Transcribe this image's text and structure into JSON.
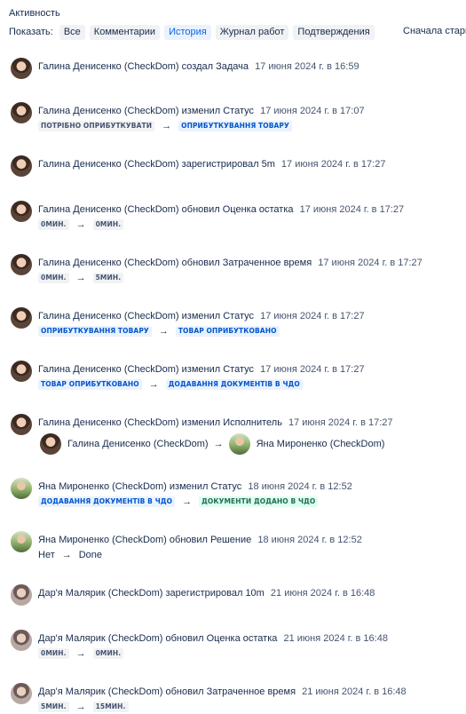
{
  "header": {
    "title": "Активность"
  },
  "filters": {
    "label": "Показать:",
    "buttons": [
      "Все",
      "Комментарии",
      "История",
      "Журнал работ",
      "Подтверждения"
    ],
    "active": "История",
    "sort_label": "Сначала старые"
  },
  "entries": [
    {
      "user": "Галина Денисенко (CheckDom)",
      "action": "создал",
      "field": "Задача",
      "time": "17 июня 2024 г. в 16:59"
    },
    {
      "user": "Галина Денисенко (CheckDom)",
      "action": "изменил",
      "field": "Статус",
      "time": "17 июня 2024 г. в 17:07",
      "from": "ПОТРІБНО ОПРИБУТКУВАТИ",
      "to": "ОПРИБУТКУВАННЯ ТОВАРУ"
    },
    {
      "user": "Галина Денисенко (CheckDom)",
      "action": "зарегистрировал",
      "field": "5m",
      "time": "17 июня 2024 г. в 17:27"
    },
    {
      "user": "Галина Денисенко (CheckDom)",
      "action": "обновил",
      "field": "Оценка остатка",
      "time": "17 июня 2024 г. в 17:27",
      "from": "0мин.",
      "to": "0мин."
    },
    {
      "user": "Галина Денисенко (CheckDom)",
      "action": "обновил",
      "field": "Затраченное время",
      "time": "17 июня 2024 г. в 17:27",
      "from": "0мин.",
      "to": "5мин."
    },
    {
      "user": "Галина Денисенко (CheckDom)",
      "action": "изменил",
      "field": "Статус",
      "time": "17 июня 2024 г. в 17:27",
      "from": "ОПРИБУТКУВАННЯ ТОВАРУ",
      "to": "ТОВАР ОПРИБУТКОВАНО"
    },
    {
      "user": "Галина Денисенко (CheckDom)",
      "action": "изменил",
      "field": "Статус",
      "time": "17 июня 2024 г. в 17:27",
      "from": "ТОВАР ОПРИБУТКОВАНО",
      "to": "ДОДАВАННЯ ДОКУМЕНТІВ В ЧДО"
    },
    {
      "user": "Галина Денисенко (CheckDom)",
      "action": "изменил",
      "field": "Исполнитель",
      "time": "17 июня 2024 г. в 17:27",
      "from": "Галина Денисенко (CheckDom)",
      "to": "Яна Мироненко (CheckDom)"
    },
    {
      "user": "Яна Мироненко (CheckDom)",
      "action": "изменил",
      "field": "Статус",
      "time": "18 июня 2024 г. в 12:52",
      "from": "ДОДАВАННЯ ДОКУМЕНТІВ В ЧДО",
      "to": "ДОКУМЕНТИ ДОДАНО В ЧДО"
    },
    {
      "user": "Яна Мироненко (CheckDom)",
      "action": "обновил",
      "field": "Решение",
      "time": "18 июня 2024 г. в 12:52",
      "from": "Нет",
      "to": "Done"
    },
    {
      "user": "Дар'я Малярик (CheckDom)",
      "action": "зарегистрировал",
      "field": "10m",
      "time": "21 июня 2024 г. в 16:48"
    },
    {
      "user": "Дар'я Малярик (CheckDom)",
      "action": "обновил",
      "field": "Оценка остатка",
      "time": "21 июня 2024 г. в 16:48",
      "from": "0мин.",
      "to": "0мин."
    },
    {
      "user": "Дар'я Малярик (CheckDom)",
      "action": "обновил",
      "field": "Затраченное время",
      "time": "21 июня 2024 г. в 16:48",
      "from": "5мин.",
      "to": "15мин."
    }
  ],
  "colors": {
    "accent": "#0c66e4",
    "lozenge_blue_bg": "#e9f2ff",
    "lozenge_gray_bg": "#f1f2f4",
    "lozenge_green_bg": "#dcfff1"
  }
}
